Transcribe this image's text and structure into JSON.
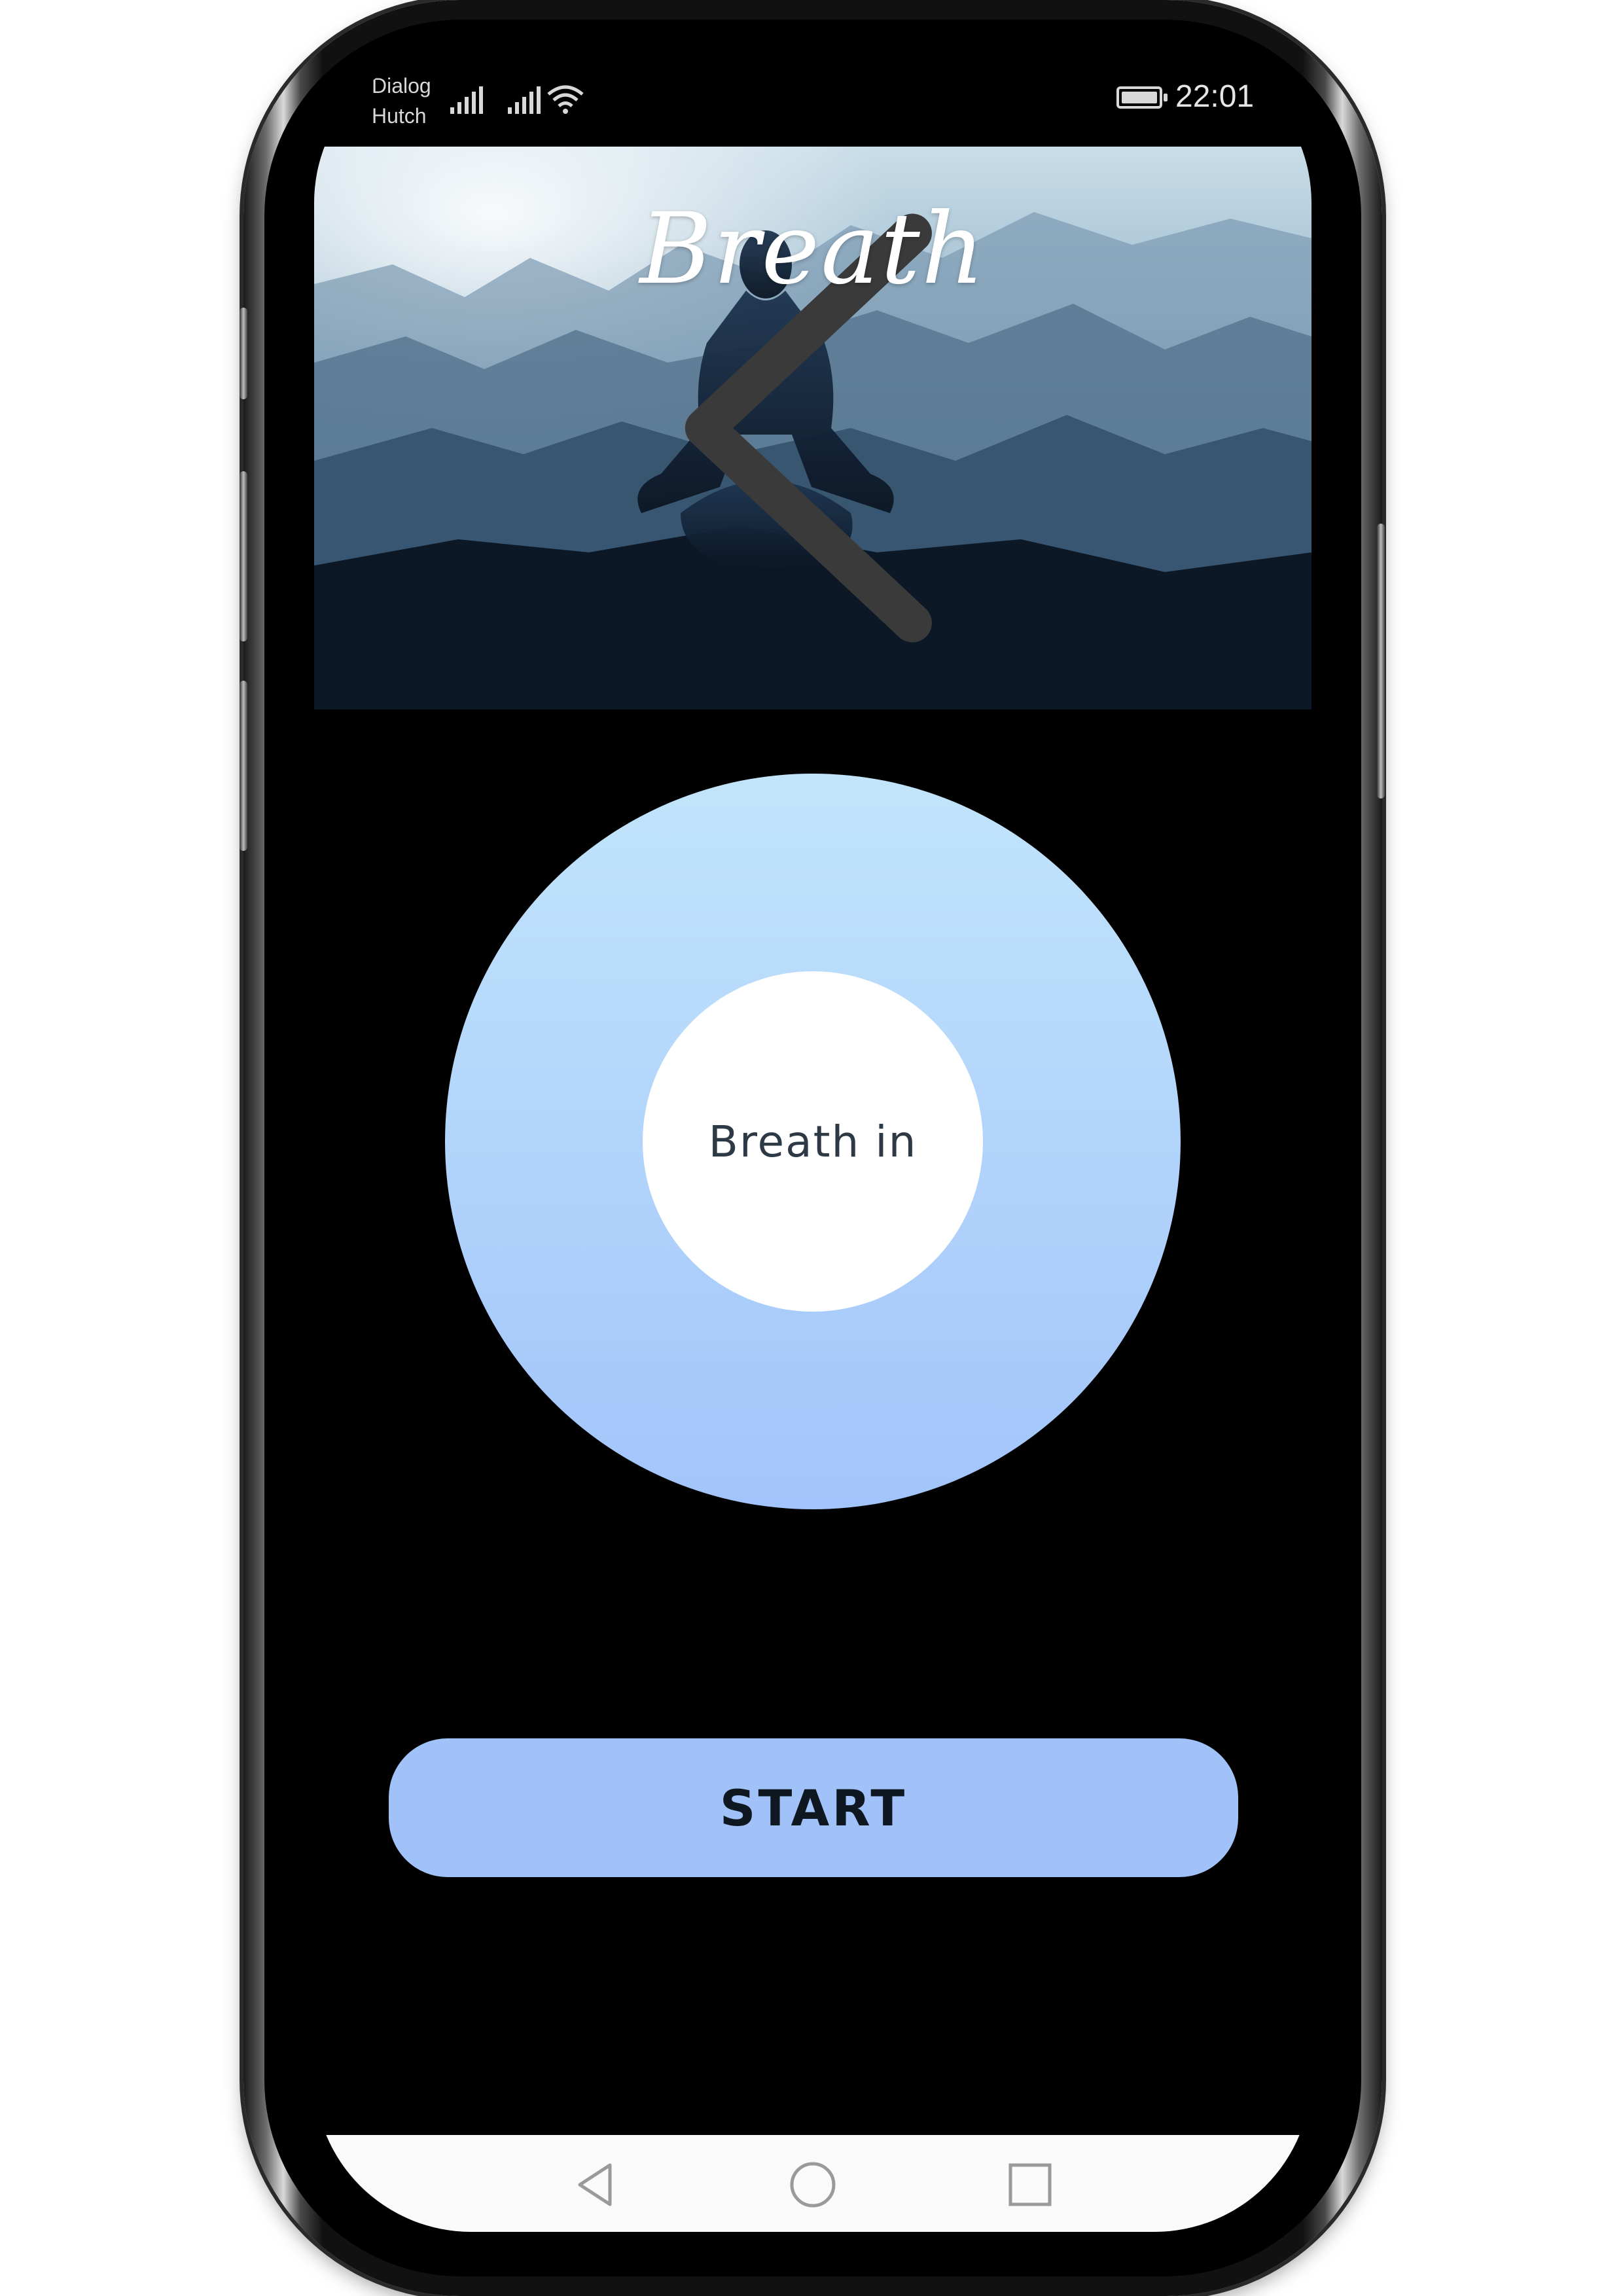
{
  "status_bar": {
    "carrier_line1": "Dialog",
    "carrier_line2": "Hutch",
    "time": "22:01",
    "icons": [
      "signal-icon",
      "signal-icon",
      "wifi-icon",
      "battery-icon"
    ]
  },
  "header": {
    "title": "Breath",
    "back_icon": "chevron-left-icon"
  },
  "breathing": {
    "label": "Breath in",
    "colors": {
      "ring_top": "#c2e5fb",
      "ring_bottom": "#a2c4fa",
      "center": "#ffffff"
    }
  },
  "start_button": {
    "label": "START",
    "color": "#a0c2f8"
  },
  "nav_bar": {
    "icons": [
      "back-triangle-icon",
      "home-circle-icon",
      "recents-square-icon"
    ]
  }
}
